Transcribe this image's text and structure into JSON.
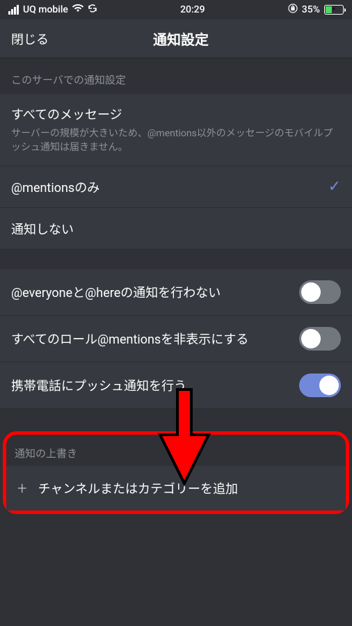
{
  "statusBar": {
    "carrier": "UQ mobile",
    "time": "20:29",
    "batteryPercent": "35%"
  },
  "header": {
    "closeLabel": "閉じる",
    "title": "通知設定"
  },
  "section1": {
    "header": "このサーバでの通知設定",
    "row1": {
      "label": "すべてのメッセージ",
      "sublabel": "サーバーの規模が大きいため、@mentions以外のメッセージのモバイルプッシュ通知は届きません。"
    },
    "row2": {
      "label": "@mentionsのみ"
    },
    "row3": {
      "label": "通知しない"
    }
  },
  "section2": {
    "row1": {
      "label": "@everyoneと@hereの通知を行わない"
    },
    "row2": {
      "label": "すべてのロール@mentionsを非表示にする"
    },
    "row3": {
      "label": "携帯電話にプッシュ通知を行う"
    }
  },
  "section3": {
    "header": "通知の上書き",
    "addLabel": "チャンネルまたはカテゴリーを追加"
  }
}
